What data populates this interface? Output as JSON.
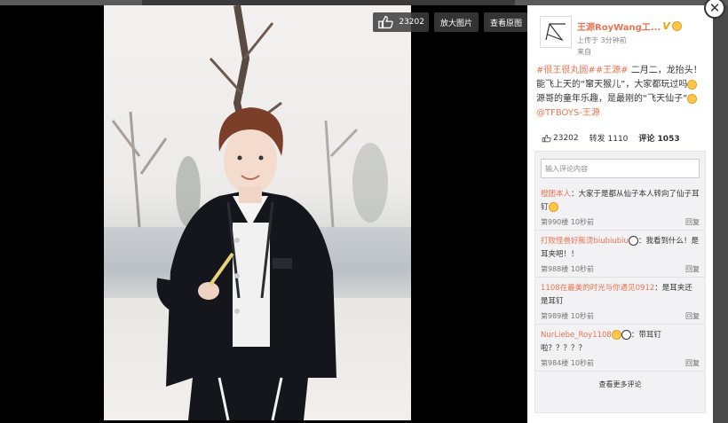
{
  "toolbar": {
    "like_count": "23202",
    "zoom_label": "放大图片",
    "original_label": "查看原图"
  },
  "author": {
    "name": "王源RoyWang工...",
    "verified_badge": "V",
    "post_time": "上传于 3分钟前",
    "source": "来自"
  },
  "post": {
    "tag1": "#很王很丸圆#",
    "tag2": "#王源#",
    "line1": "二月二，龙抬头！",
    "line2": "能飞上天的“窜天猴儿”，大家都玩过吗",
    "line3": "源哥的童年乐趣，是最刚的“飞天仙子”",
    "mention": "@TFBOYS-王源"
  },
  "stats": {
    "likes": "23202",
    "reposts": "转发 1110",
    "comments": "评论 1053"
  },
  "comment_box": {
    "placeholder": "输入评论内容"
  },
  "comments": [
    {
      "user": "橙团本人",
      "text": "：大家于是都从仙子本人转向了仙子耳钉",
      "floor": "第990楼",
      "time": "10秒前",
      "reply": "回复"
    },
    {
      "user": "打败怪兽好膨烫biubiubiu",
      "text": "：我看到什么！是耳夹吧！！",
      "floor": "第988楼",
      "time": "10秒前",
      "reply": "回复"
    },
    {
      "user": "1108在最美的时光与你遇见0912",
      "text": "：是耳夹还是耳钉",
      "floor": "第989楼",
      "time": "10秒前",
      "reply": "回复"
    },
    {
      "user": "NurLiebe_Roy1108",
      "text": "：带耳钉啦？？？？？",
      "floor": "第984楼",
      "time": "10秒前",
      "reply": "回复"
    }
  ],
  "more_label": "查看更多评论"
}
